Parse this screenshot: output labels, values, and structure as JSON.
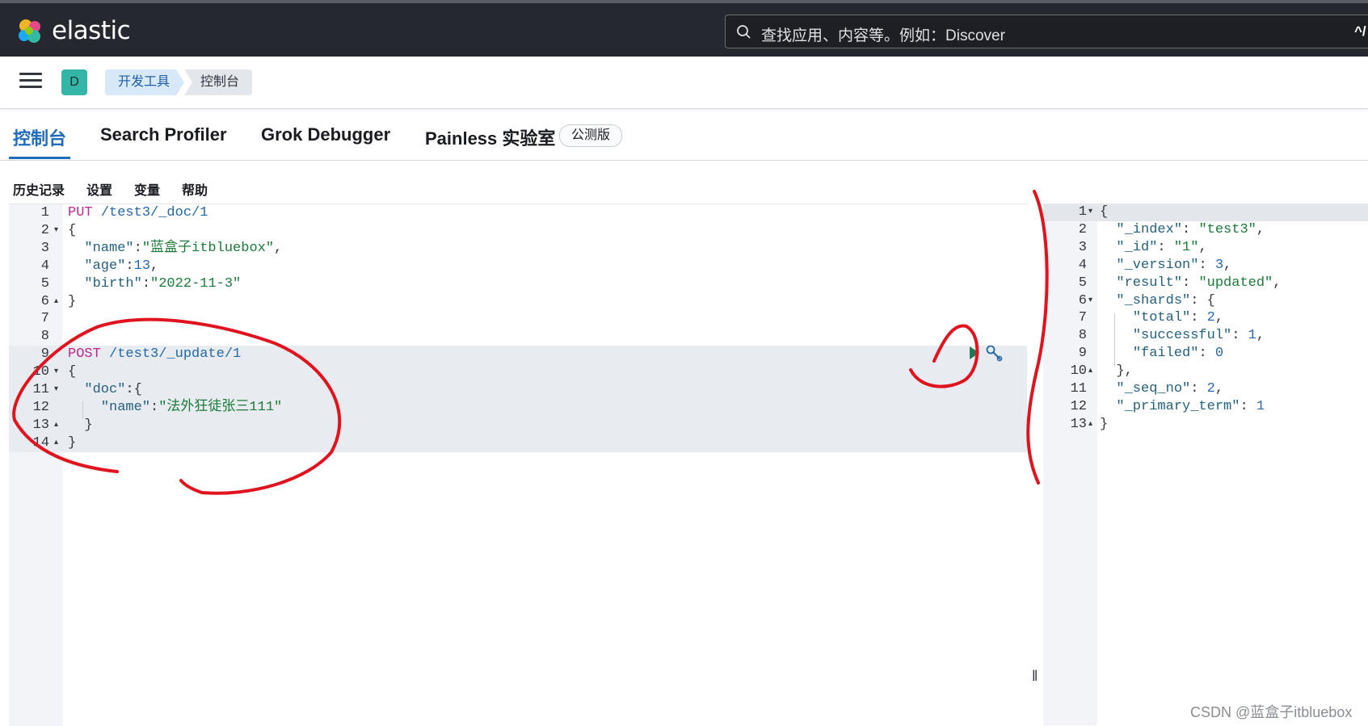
{
  "header": {
    "brand": "elastic",
    "search_placeholder": "查找应用、内容等。例如：Discover",
    "shortcut": "^/"
  },
  "breadcrumbs": {
    "avatar": "D",
    "items": [
      "开发工具",
      "控制台"
    ]
  },
  "tabs": [
    {
      "label": "控制台",
      "active": true
    },
    {
      "label": "Search Profiler",
      "active": false
    },
    {
      "label": "Grok Debugger",
      "active": false
    },
    {
      "label": "Painless 实验室",
      "active": false
    }
  ],
  "beta_badge": "公测版",
  "toolbar": [
    "历史记录",
    "设置",
    "变量",
    "帮助"
  ],
  "editor": {
    "lines": [
      {
        "n": "1",
        "fold": "",
        "text": "PUT /test3/_doc/1"
      },
      {
        "n": "2",
        "fold": "down",
        "text": "{"
      },
      {
        "n": "3",
        "fold": "",
        "text": "  \"name\":\"蓝盒子itbluebox\","
      },
      {
        "n": "4",
        "fold": "",
        "text": "  \"age\":13,"
      },
      {
        "n": "5",
        "fold": "",
        "text": "  \"birth\":\"2022-11-3\""
      },
      {
        "n": "6",
        "fold": "up",
        "text": "}"
      },
      {
        "n": "7",
        "fold": "",
        "text": ""
      },
      {
        "n": "8",
        "fold": "",
        "text": ""
      },
      {
        "n": "9",
        "fold": "",
        "text": "POST /test3/_update/1"
      },
      {
        "n": "10",
        "fold": "down",
        "text": "{"
      },
      {
        "n": "11",
        "fold": "down",
        "text": "  \"doc\":{"
      },
      {
        "n": "12",
        "fold": "",
        "text": "    \"name\":\"法外狂徒张三111\""
      },
      {
        "n": "13",
        "fold": "up",
        "text": "  }"
      },
      {
        "n": "14",
        "fold": "up",
        "text": "}"
      }
    ]
  },
  "output": {
    "lines": [
      {
        "n": "1",
        "fold": "down",
        "text": "{"
      },
      {
        "n": "2",
        "fold": "",
        "text": "  \"_index\": \"test3\","
      },
      {
        "n": "3",
        "fold": "",
        "text": "  \"_id\": \"1\","
      },
      {
        "n": "4",
        "fold": "",
        "text": "  \"_version\": 3,"
      },
      {
        "n": "5",
        "fold": "",
        "text": "  \"result\": \"updated\","
      },
      {
        "n": "6",
        "fold": "down",
        "text": "  \"_shards\": {"
      },
      {
        "n": "7",
        "fold": "",
        "text": "    \"total\": 2,"
      },
      {
        "n": "8",
        "fold": "",
        "text": "    \"successful\": 1,"
      },
      {
        "n": "9",
        "fold": "",
        "text": "    \"failed\": 0"
      },
      {
        "n": "10",
        "fold": "up",
        "text": "  },"
      },
      {
        "n": "11",
        "fold": "",
        "text": "  \"_seq_no\": 2,"
      },
      {
        "n": "12",
        "fold": "",
        "text": "  \"_primary_term\": 1"
      },
      {
        "n": "13",
        "fold": "up",
        "text": "}"
      }
    ]
  },
  "watermark": "CSDN @蓝盒子itbluebox",
  "colors": {
    "header_bg": "#25282f",
    "accent": "#1f6cbf",
    "annotation_red": "#e0141e"
  }
}
